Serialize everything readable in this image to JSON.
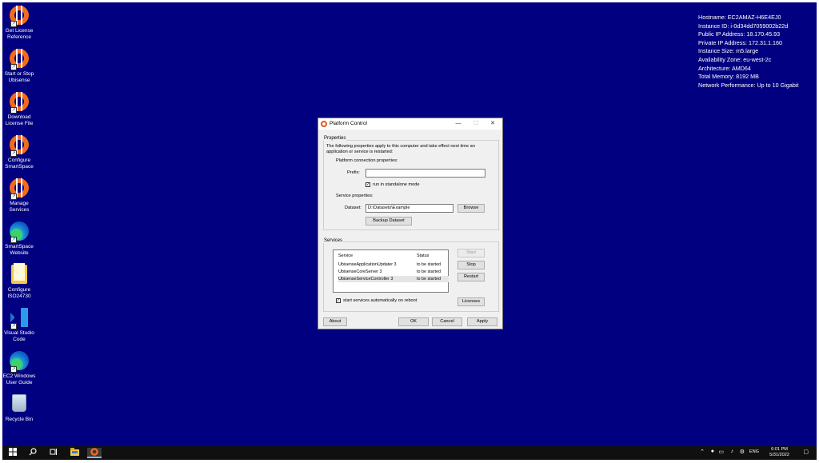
{
  "desktop": {
    "icons": [
      {
        "label": "Get License Reference",
        "icon": "lifering-icon"
      },
      {
        "label": "Start or Stop Ubisense",
        "icon": "lifering-icon"
      },
      {
        "label": "Download License File",
        "icon": "lifering-icon"
      },
      {
        "label": "Configure SmartSpace",
        "icon": "lifering-icon"
      },
      {
        "label": "Manage Services",
        "icon": "lifering-icon"
      },
      {
        "label": "SmartSpace Website",
        "icon": "edge-icon"
      },
      {
        "label": "Configure ISO24730",
        "icon": "file-icon"
      },
      {
        "label": "Visual Studio Code",
        "icon": "vscode-icon"
      },
      {
        "label": "EC2 Windows User Guide",
        "icon": "edge-icon"
      },
      {
        "label": "Recycle Bin",
        "icon": "recycle-bin-icon"
      }
    ],
    "info": [
      "Hostname: EC2AMAZ-H6E4EJ0",
      "Instance ID: i-0d34dd7059002b22d",
      "Public IP Address: 18.170.45.93",
      "Private IP Address: 172.31.1.160",
      "Instance Size: m5.large",
      "Availability Zone: eu-west-2c",
      "Architecture: AMD64",
      "Total Memory: 8192 MB",
      "Network Performance: Up to 10 Gigabit"
    ],
    "background_color": "#010080"
  },
  "window": {
    "title": "Platform Control",
    "controls": {
      "minimize": "—",
      "maximize": "☐",
      "close": "✕"
    },
    "properties": {
      "group_label": "Properties",
      "description": "The following properties apply to this computer and take effect next time an application or service is restarted:",
      "connection_heading": "Platform connection properties:",
      "prefix_label": "Prefix:",
      "prefix_value": "",
      "standalone_label": "run in standalone mode",
      "standalone_checked": true,
      "service_heading": "Service properties:",
      "dataset_label": "Dataset:",
      "dataset_value": "D:\\Datasets\\Example",
      "browse_label": "Browse",
      "backup_label": "Backup Dataset"
    },
    "services": {
      "group_label": "Services",
      "columns": [
        "Service",
        "Status"
      ],
      "rows": [
        {
          "service": "UbisenseApplicationUpdater 3",
          "status": "to be started",
          "selected": false
        },
        {
          "service": "UbisenseCoreServer 3",
          "status": "to be started",
          "selected": false
        },
        {
          "service": "UbisenseServiceController 3",
          "status": "to be started",
          "selected": true
        }
      ],
      "start_label": "Start",
      "stop_label": "Stop",
      "restart_label": "Restart",
      "autostart_label": "start services automatically on reboot",
      "autostart_checked": true,
      "licenses_label": "Licenses"
    },
    "footer": {
      "about_label": "About",
      "ok_label": "OK",
      "cancel_label": "Cancel",
      "apply_label": "Apply"
    }
  },
  "taskbar": {
    "language": "ENG",
    "time": "6:01 PM",
    "date": "5/31/2022"
  }
}
